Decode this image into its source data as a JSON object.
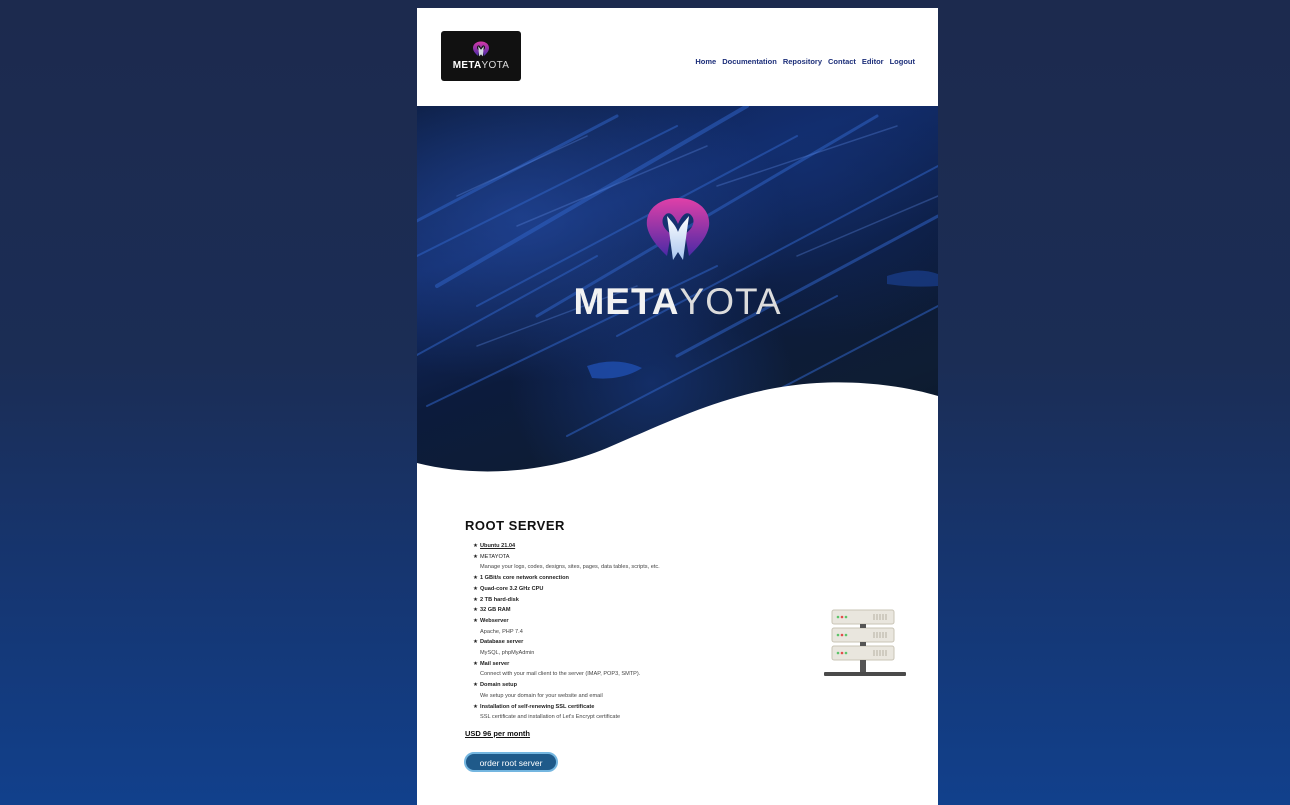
{
  "header": {
    "logo": {
      "bold": "META",
      "light": "YOTA"
    },
    "nav": [
      "Home",
      "Documentation",
      "Repository",
      "Contact",
      "Editor",
      "Logout"
    ]
  },
  "hero": {
    "title_bold": "META",
    "title_light": "YOTA"
  },
  "main": {
    "section_title": "ROOT SERVER",
    "features": [
      {
        "text": "Ubuntu 21.04",
        "style": "underline"
      },
      {
        "text": "METAYOTA",
        "style": "normal"
      },
      {
        "text": "Manage your logs, codes, designs, sites, pages, data tables, scripts, etc.",
        "style": "sub"
      },
      {
        "text": "1 GBit/s core network connection",
        "style": "bold"
      },
      {
        "text": "Quad-core 3.2 GHz CPU",
        "style": "bold"
      },
      {
        "text": "2 TB hard-disk",
        "style": "bold"
      },
      {
        "text": "32 GB RAM",
        "style": "bold"
      },
      {
        "text": "Webserver",
        "style": "bold"
      },
      {
        "text": "Apache, PHP 7.4",
        "style": "sub"
      },
      {
        "text": "Database server",
        "style": "bold"
      },
      {
        "text": "MySQL, phpMyAdmin",
        "style": "sub"
      },
      {
        "text": "Mail server",
        "style": "bold"
      },
      {
        "text": "Connect with your mail client to the server (IMAP, POP3, SMTP).",
        "style": "sub"
      },
      {
        "text": "Domain setup",
        "style": "bold"
      },
      {
        "text": "We setup your domain for your website and email",
        "style": "sub"
      },
      {
        "text": "Installation of self-renewing SSL certificate",
        "style": "bold"
      },
      {
        "text": "SSL certificate and installation of Let's Encrypt certificate",
        "style": "sub"
      }
    ],
    "price": "USD 96 per month",
    "order_button": "order root server"
  },
  "colors": {
    "nav_link": "#1d2f7a",
    "button_bg": "#1f5a8a",
    "button_border": "#74b6e0",
    "logo_gradient_top": "#d63aa8",
    "logo_gradient_bottom": "#4a2aa8"
  },
  "icons": {
    "feature_bullet": "star-icon",
    "logo_mark": "metayota-logo-icon",
    "server_illustration": "server-rack-icon"
  }
}
